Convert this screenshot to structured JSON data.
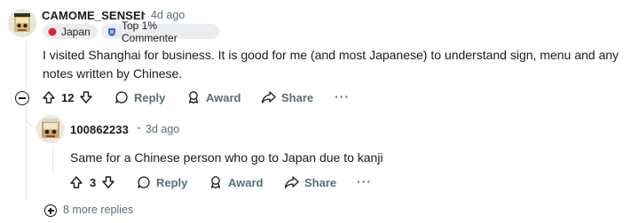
{
  "comment": {
    "username": "CAMOME_SENSEI",
    "time": "4d ago",
    "flairs": [
      {
        "label": "Japan",
        "icon": "red-circle-icon",
        "color": "#e0242b"
      },
      {
        "label": "Top 1% Commenter",
        "icon": "top-commenter-icon",
        "color": "#3b6ec8"
      }
    ],
    "text_line1": "I visited Shanghai for business. It is good for me (and most Japanese) to understand sign, menu and any",
    "text_line2": "notes written by Chinese.",
    "votes": "12",
    "reply_label": "Reply",
    "award_label": "Award",
    "share_label": "Share",
    "more_label": "···"
  },
  "reply": {
    "username": "100862233",
    "time": "3d ago",
    "text": "Same for a Chinese person who go to Japan due to kanji",
    "votes": "3",
    "reply_label": "Reply",
    "award_label": "Award",
    "share_label": "Share",
    "more_label": "···"
  },
  "more_replies": "8 more replies",
  "separator": "•",
  "colors": {
    "muted": "#576f76",
    "text": "#1a1a1b",
    "flair_bg": "#eaedef",
    "thread_line": "#e5e8ea"
  }
}
